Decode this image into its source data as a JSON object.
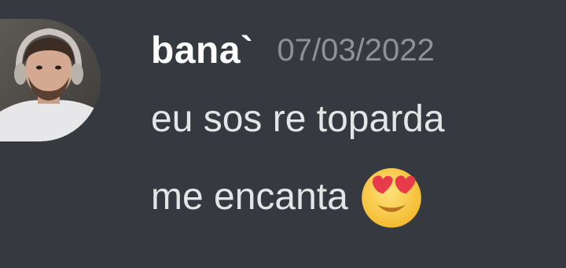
{
  "message": {
    "author": "bana`",
    "timestamp": "07/03/2022",
    "lines": [
      "eu sos re toparda",
      "me encanta"
    ],
    "emoji": "heart-eyes-emoji"
  },
  "colors": {
    "background": "#36393f",
    "username": "#ffffff",
    "timestamp": "#8e9297",
    "message_text": "#e4e5e7"
  }
}
